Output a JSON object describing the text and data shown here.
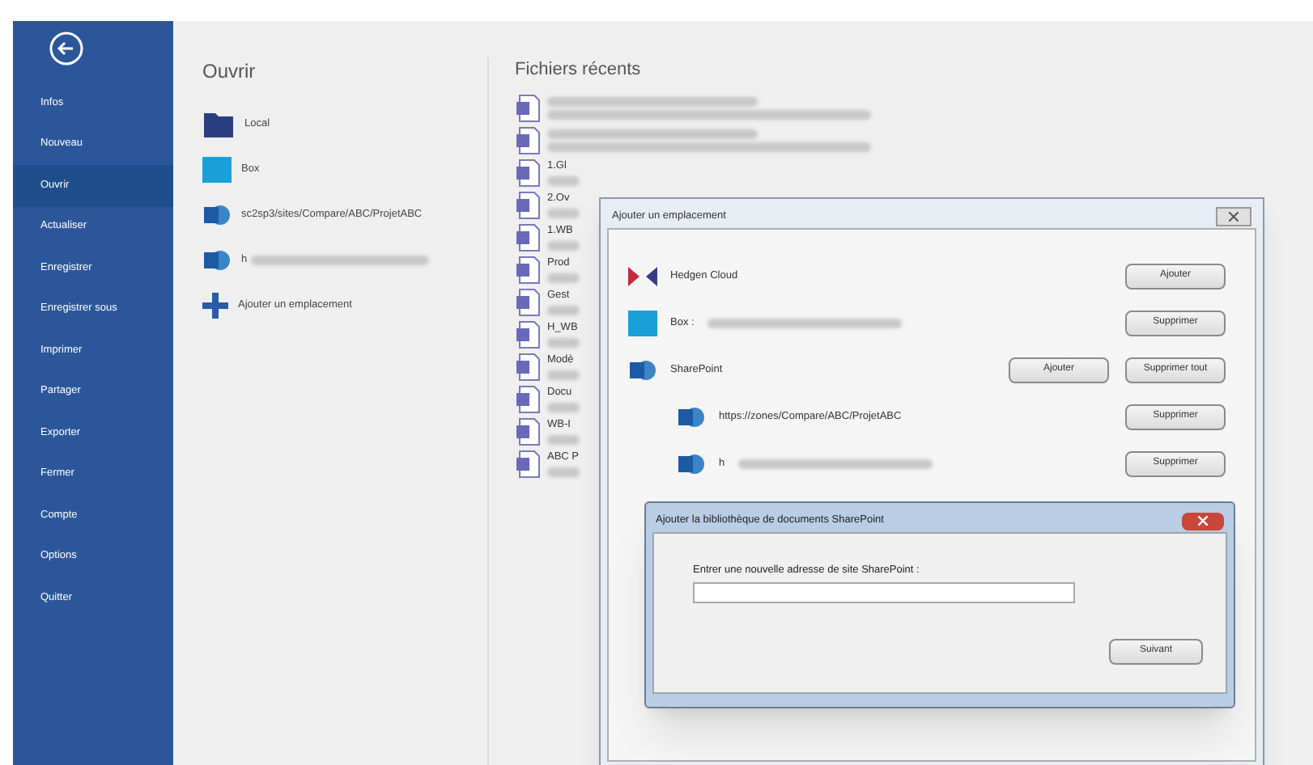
{
  "sidebar": {
    "items": [
      {
        "label": "Infos",
        "selected": false
      },
      {
        "label": "Nouveau",
        "selected": false
      },
      {
        "label": "Ouvrir",
        "selected": true
      },
      {
        "label": "Actualiser",
        "selected": false
      },
      {
        "label": "Enregistrer",
        "selected": false
      },
      {
        "label": "Enregistrer sous",
        "selected": false
      },
      {
        "label": "Imprimer",
        "selected": false
      },
      {
        "label": "Partager",
        "selected": false
      },
      {
        "label": "Exporter",
        "selected": false
      },
      {
        "label": "Fermer",
        "selected": false
      },
      {
        "label": "Compte",
        "selected": false
      },
      {
        "label": "Options",
        "selected": false
      },
      {
        "label": "Quitter",
        "selected": false
      }
    ]
  },
  "open": {
    "title": "Ouvrir",
    "places": [
      {
        "kind": "folder",
        "label": "Local"
      },
      {
        "kind": "box",
        "label": "Box"
      },
      {
        "kind": "sharepoint",
        "label": "sc2sp3/sites/Compare/ABC/ProjetABC"
      },
      {
        "kind": "sharepoint",
        "label": "h"
      },
      {
        "kind": "add",
        "label": "Ajouter un emplacement"
      }
    ]
  },
  "recent": {
    "title": "Fichiers récents",
    "files": [
      {
        "blurred": true
      },
      {
        "blurred": true
      },
      {
        "name": "1.Gl"
      },
      {
        "name": "2.Ov"
      },
      {
        "name": "1.WB"
      },
      {
        "name": "Prod"
      },
      {
        "name": "Gest"
      },
      {
        "name": "H_WB"
      },
      {
        "name": "Modè"
      },
      {
        "name": "Docu"
      },
      {
        "name": "WB-I"
      },
      {
        "name": "ABC P"
      }
    ]
  },
  "add_place_dialog": {
    "title": "Ajouter un emplacement",
    "services": [
      {
        "kind": "cloud",
        "label": "Hedgen Cloud",
        "buttons": [
          "Ajouter"
        ]
      },
      {
        "kind": "box",
        "label": "Box :",
        "buttons": [
          "Supprimer"
        ]
      },
      {
        "kind": "sharepoint",
        "label": "SharePoint",
        "buttons": [
          "Ajouter",
          "Supprimer tout"
        ]
      },
      {
        "kind": "site",
        "label": "https://zones/Compare/ABC/ProjetABC",
        "buttons": [
          "Supprimer"
        ]
      },
      {
        "kind": "site",
        "label": "h",
        "buttons": [
          "Supprimer"
        ]
      }
    ]
  },
  "sharepoint_dialog": {
    "title": "Ajouter la bibliothèque de documents SharePoint",
    "prompt": "Entrer une nouvelle adresse de site SharePoint :",
    "button": "Suivant"
  }
}
